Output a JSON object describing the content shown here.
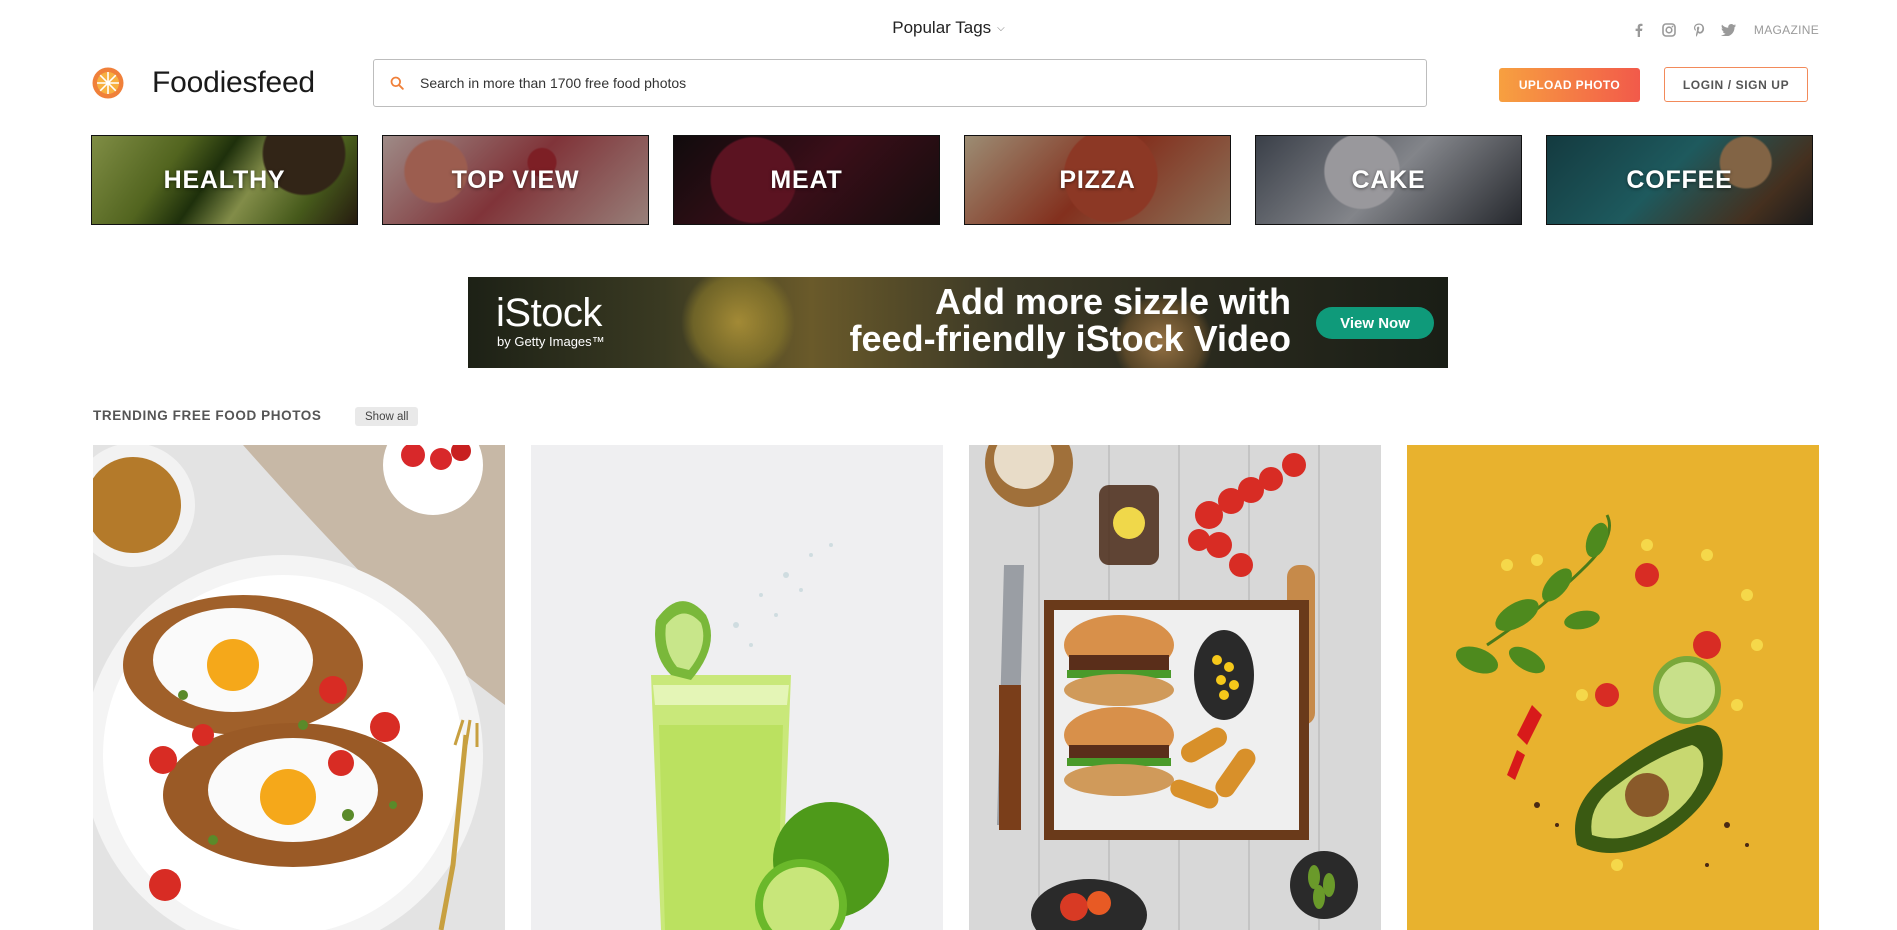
{
  "topbar": {
    "popular_tags": "Popular Tags",
    "magazine": "MAGAZINE",
    "social_icons": [
      "facebook-icon",
      "instagram-icon",
      "pinterest-icon",
      "twitter-icon"
    ]
  },
  "header": {
    "brand": "Foodiesfeed",
    "search_placeholder": "Search in more than 1700 free food photos",
    "upload_label": "UPLOAD PHOTO",
    "login_label": "LOGIN / SIGN UP"
  },
  "categories": [
    {
      "label": "HEALTHY"
    },
    {
      "label": "TOP VIEW"
    },
    {
      "label": "MEAT"
    },
    {
      "label": "PIZZA"
    },
    {
      "label": "CAKE"
    },
    {
      "label": "COFFEE"
    }
  ],
  "ad": {
    "brand": "iStock",
    "sub_brand": "by Getty Images™",
    "headline_line1": "Add more sizzle with",
    "headline_line2": "feed-friendly iStock Video",
    "cta": "View Now"
  },
  "trending": {
    "title": "TRENDING FREE FOOD PHOTOS",
    "show_all": "Show all"
  },
  "colors": {
    "accent_orange": "#f7a040",
    "accent_red": "#f25a4a",
    "ad_cta": "#0f9a7a"
  }
}
